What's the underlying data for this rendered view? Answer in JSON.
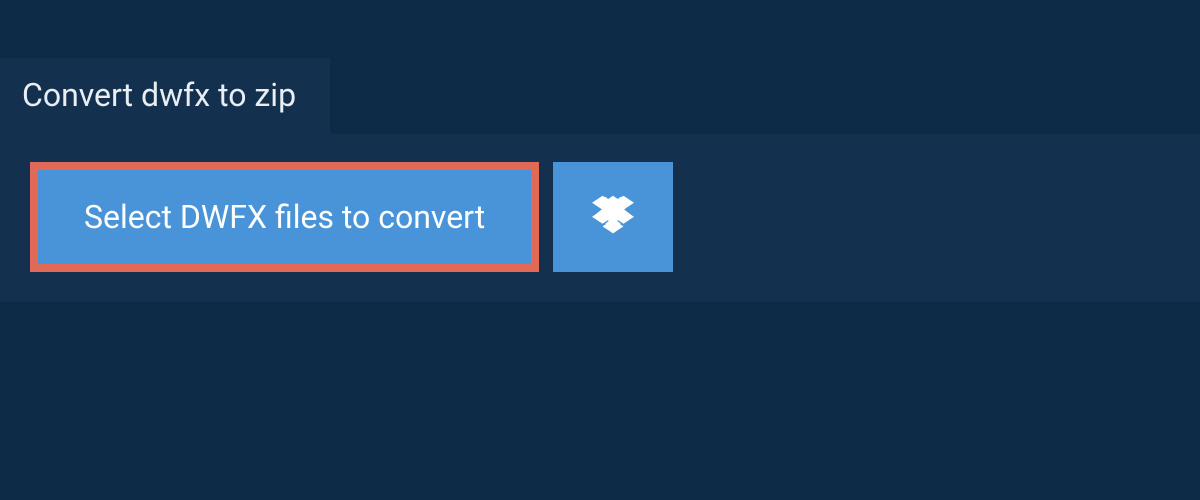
{
  "tab": {
    "title": "Convert dwfx to zip"
  },
  "actions": {
    "select_label": "Select DWFX files to convert"
  },
  "icons": {
    "dropbox": "dropbox-icon"
  },
  "colors": {
    "background": "#0d2b47",
    "panel": "#13314f",
    "button": "#4993d8",
    "highlight_border": "#e16a57",
    "text_light": "#ffffff"
  }
}
